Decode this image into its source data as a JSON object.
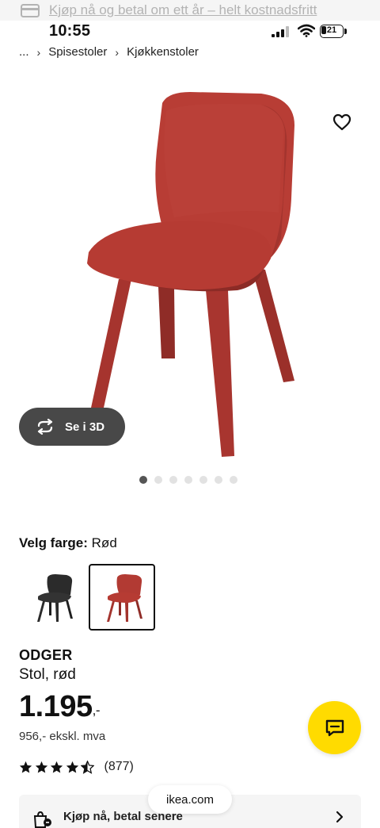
{
  "banner": {
    "text": "Kjøp nå og betal om ett år – helt kostnadsfritt",
    "icon": "credit-card-icon"
  },
  "status_bar": {
    "time": "10:55",
    "battery": "21"
  },
  "breadcrumb": {
    "ellipsis": "...",
    "items": [
      "Spisestoler",
      "Kjøkkenstoler"
    ]
  },
  "gallery": {
    "see_3d_label": "Se i 3D",
    "image_count": 7,
    "active_index": 0,
    "favorite_icon": "heart-icon"
  },
  "color_selector": {
    "label": "Velg farge:",
    "selected": "Rød",
    "options": [
      "black",
      "red"
    ]
  },
  "product": {
    "name": "ODGER",
    "description": "Stol, rød",
    "price": "1.195",
    "price_suffix": ",-",
    "price_ex_vat": "956,- ekskl. mva",
    "rating": 4.5,
    "rating_count": "(877)"
  },
  "bnpl": {
    "label": "Kjøp nå, betal senere"
  },
  "browser": {
    "url": "ikea.com"
  },
  "colors": {
    "chair_red": "#b23a33",
    "chair_black": "#2b2b2b",
    "ikea_yellow": "#ffdb00",
    "pill_dark": "#484848"
  }
}
